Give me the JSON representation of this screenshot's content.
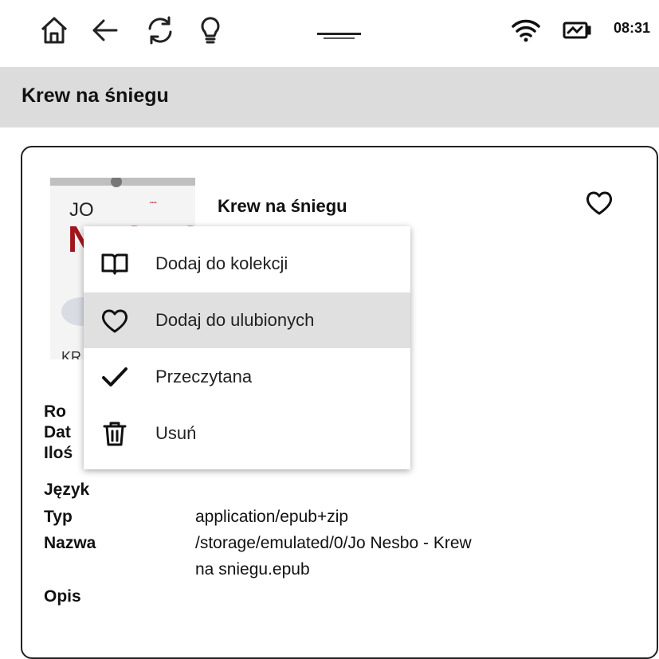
{
  "status_bar": {
    "icons": [
      "home-icon",
      "back-arrow-icon",
      "refresh-icon",
      "lightbulb-icon",
      "wifi-icon",
      "battery-charging-icon"
    ],
    "clock": "08:31"
  },
  "title_bar": {
    "title": "Krew na śniegu"
  },
  "book": {
    "cover": {
      "author": "JO",
      "surname": "NESBØ",
      "title_fragment": "KR"
    },
    "title": "Krew na śniegu",
    "favorite_icon": "heart-outline-icon"
  },
  "details": {
    "rows": [
      {
        "label": "Ro",
        "value": ""
      },
      {
        "label": "Dat",
        "value": ""
      },
      {
        "label": "Iloś",
        "value": ""
      },
      {
        "label": "Język",
        "value": ""
      },
      {
        "label": "Typ",
        "value": "application/epub+zip"
      },
      {
        "label": "Nazwa",
        "value": "/storage/emulated/0/Jo Nesbo - Krew",
        "value2": "na sniegu.epub"
      },
      {
        "label": "Opis",
        "value": ""
      }
    ]
  },
  "context_menu": {
    "items": [
      {
        "label": "Dodaj do kolekcji",
        "icon": "book-open-icon"
      },
      {
        "label": "Dodaj do ulubionych",
        "icon": "heart-outline-icon",
        "selected": true
      },
      {
        "label": "Przeczytana",
        "icon": "checkmark-icon"
      },
      {
        "label": "Usuń",
        "icon": "trash-icon"
      }
    ]
  }
}
